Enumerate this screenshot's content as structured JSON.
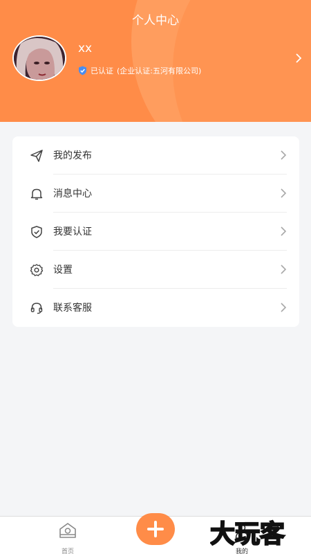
{
  "header": {
    "title": "个人中心",
    "username": "xx",
    "verify_status": "已认证",
    "verify_detail": "(企业认证:五河有限公司)"
  },
  "menu": {
    "items": [
      {
        "label": "我的发布",
        "icon": "send-icon"
      },
      {
        "label": "消息中心",
        "icon": "bell-icon"
      },
      {
        "label": "我要认证",
        "icon": "shield-check-icon"
      },
      {
        "label": "设置",
        "icon": "gear-icon"
      },
      {
        "label": "联系客服",
        "icon": "headset-icon"
      }
    ]
  },
  "tabbar": {
    "home_label": "首页",
    "mine_label": "我的",
    "add_icon": "plus-icon"
  },
  "watermark": {
    "text": "大玩客"
  },
  "colors": {
    "accent": "#ff8c48",
    "background": "#f4f5f7",
    "verified": "#4a8df0"
  }
}
